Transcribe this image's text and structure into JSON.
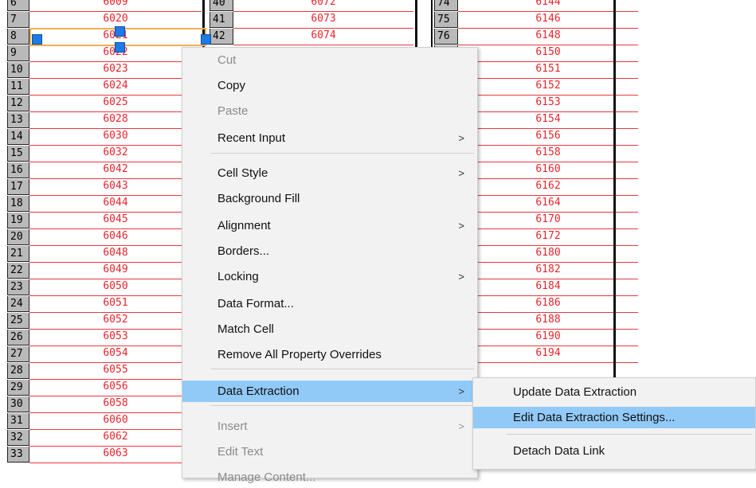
{
  "table1": {
    "rows": [
      {
        "n": "6",
        "v": "6009"
      },
      {
        "n": "7",
        "v": "6020"
      },
      {
        "n": "8",
        "v": "6021"
      },
      {
        "n": "9",
        "v": "6022"
      },
      {
        "n": "10",
        "v": "6023"
      },
      {
        "n": "11",
        "v": "6024"
      },
      {
        "n": "12",
        "v": "6025"
      },
      {
        "n": "13",
        "v": "6028"
      },
      {
        "n": "14",
        "v": "6030"
      },
      {
        "n": "15",
        "v": "6032"
      },
      {
        "n": "16",
        "v": "6042"
      },
      {
        "n": "17",
        "v": "6043"
      },
      {
        "n": "18",
        "v": "6044"
      },
      {
        "n": "19",
        "v": "6045"
      },
      {
        "n": "20",
        "v": "6046"
      },
      {
        "n": "21",
        "v": "6048"
      },
      {
        "n": "22",
        "v": "6049"
      },
      {
        "n": "23",
        "v": "6050"
      },
      {
        "n": "24",
        "v": "6051"
      },
      {
        "n": "25",
        "v": "6052"
      },
      {
        "n": "26",
        "v": "6053"
      },
      {
        "n": "27",
        "v": "6054"
      },
      {
        "n": "28",
        "v": "6055"
      },
      {
        "n": "29",
        "v": "6056"
      },
      {
        "n": "30",
        "v": "6058"
      },
      {
        "n": "31",
        "v": "6060"
      },
      {
        "n": "32",
        "v": "6062"
      },
      {
        "n": "33",
        "v": "6063"
      }
    ]
  },
  "table2": {
    "rows": [
      {
        "n": "40",
        "v": "6072"
      },
      {
        "n": "41",
        "v": "6073"
      },
      {
        "n": "42",
        "v": "6074"
      }
    ]
  },
  "table3": {
    "rows": [
      {
        "n": "74",
        "v": "6144"
      },
      {
        "n": "75",
        "v": "6146"
      },
      {
        "n": "76",
        "v": "6148"
      },
      {
        "n": "",
        "v": "6150"
      },
      {
        "n": "",
        "v": "6151"
      },
      {
        "n": "",
        "v": "6152"
      },
      {
        "n": "",
        "v": "6153"
      },
      {
        "n": "",
        "v": "6154"
      },
      {
        "n": "",
        "v": "6156"
      },
      {
        "n": "",
        "v": "6158"
      },
      {
        "n": "",
        "v": "6160"
      },
      {
        "n": "",
        "v": "6162"
      },
      {
        "n": "",
        "v": "6164"
      },
      {
        "n": "",
        "v": "6170"
      },
      {
        "n": "",
        "v": "6172"
      },
      {
        "n": "",
        "v": "6180"
      },
      {
        "n": "",
        "v": "6182"
      },
      {
        "n": "",
        "v": "6184"
      },
      {
        "n": "",
        "v": "6186"
      },
      {
        "n": "",
        "v": "6188"
      },
      {
        "n": "",
        "v": "6190"
      },
      {
        "n": "",
        "v": "6194"
      }
    ]
  },
  "context_menu": {
    "items": [
      {
        "label": "Cut",
        "disabled": true,
        "submenu": false
      },
      {
        "label": "Copy",
        "disabled": false,
        "submenu": false
      },
      {
        "label": "Paste",
        "disabled": true,
        "submenu": false
      },
      {
        "label": "Recent Input",
        "disabled": false,
        "submenu": true
      },
      {
        "label": "Cell Style",
        "disabled": false,
        "submenu": true
      },
      {
        "label": "Background Fill",
        "disabled": false,
        "submenu": false
      },
      {
        "label": "Alignment",
        "disabled": false,
        "submenu": true
      },
      {
        "label": "Borders...",
        "disabled": false,
        "submenu": false
      },
      {
        "label": "Locking",
        "disabled": false,
        "submenu": true
      },
      {
        "label": "Data Format...",
        "disabled": false,
        "submenu": false
      },
      {
        "label": "Match Cell",
        "disabled": false,
        "submenu": false
      },
      {
        "label": "Remove All Property Overrides",
        "disabled": false,
        "submenu": false
      },
      {
        "label": "Data Extraction",
        "disabled": false,
        "submenu": true,
        "highlighted": true
      },
      {
        "label": "Insert",
        "disabled": true,
        "submenu": true
      },
      {
        "label": "Edit Text",
        "disabled": true,
        "submenu": false
      },
      {
        "label": "Manage Content...",
        "disabled": true,
        "submenu": false
      }
    ],
    "arrow_glyph": ">"
  },
  "submenu": {
    "items": [
      {
        "label": "Update Data Extraction",
        "highlighted": false
      },
      {
        "label": "Edit Data Extraction Settings...",
        "highlighted": true
      },
      {
        "label": "Detach Data Link",
        "highlighted": false
      }
    ]
  },
  "colors": {
    "text_red": "#e8242b",
    "grid_red": "#e8383e",
    "highlight": "#91c9f7",
    "grip": "#1e7ae6",
    "selection": "#f2b04f"
  }
}
